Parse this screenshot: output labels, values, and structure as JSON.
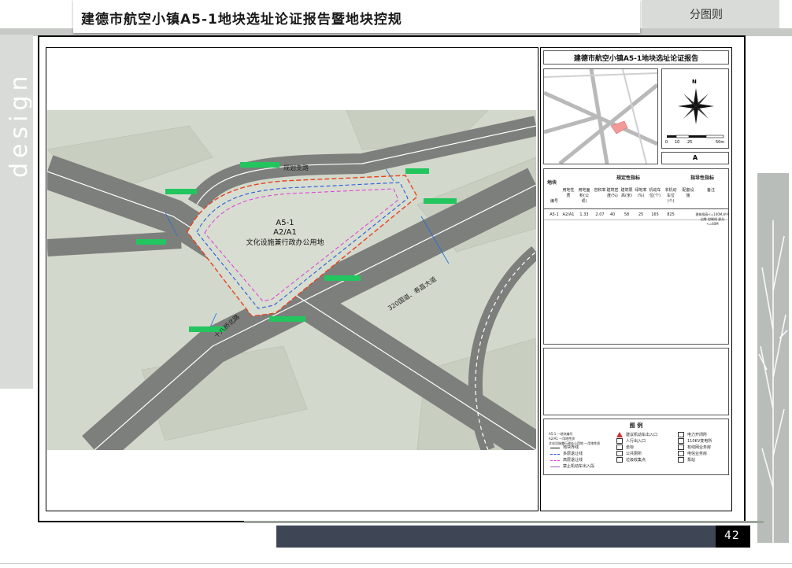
{
  "header": {
    "title": "建德市航空小镇A5-1地块选址论证报告暨地块控规",
    "section": "分图则"
  },
  "watermark": "design",
  "page_number": "42",
  "map": {
    "road_north": "规划支路",
    "road_east": "320国道、寿昌大道",
    "road_west": "十八桥北路",
    "parcel_code": "A5-1",
    "parcel_landuse": "A2/A1",
    "parcel_desc": "文化设施兼行政办公用地"
  },
  "panel": {
    "report_title": "建德市航空小镇A5-1地块选址论证报告",
    "locator_label": "A",
    "north_label": "N",
    "scale_labels": [
      "0",
      "10",
      "25",
      "50m"
    ],
    "table": {
      "group_left": "地块",
      "group_mid": "规定性指标",
      "group_right": "指导性指标",
      "headers": [
        "编号",
        "用地性质",
        "用地面积(公顷)",
        "容积率",
        "建筑密度(%)",
        "建筑限高(米)",
        "绿地率(%)",
        "机动车位(个)",
        "非机动车位(个)",
        "配套设施",
        "备注"
      ],
      "row": [
        "A5-1",
        "A2/A1",
        "1.33",
        "2.07",
        "40",
        "58",
        "25",
        "165",
        "825",
        "",
        "建筑限高<=100M,护坪边缘 控制线 部分<=60M"
      ]
    },
    "legend": {
      "title": "图 例",
      "sample_lines": [
        "A5-1 —地块编号",
        "A2/A1 —用地性质",
        "文化设施兼行政办公用地 —用地性质"
      ],
      "col1": [
        "地块界线",
        "多层退让线",
        "高层退让线",
        "禁止机动车出入段"
      ],
      "col2": [
        "建议机动车出入口",
        "人行出入口",
        "坐标",
        "公共厕所",
        "垃圾收集点"
      ],
      "col3": [
        "电力开闭所",
        "110KV变电所",
        "有线网业务房",
        "电信业务房",
        "泵站"
      ]
    }
  },
  "colors": {
    "map_bg": "#d2d8cb",
    "road": "#7d7f7d",
    "parcel_line": "#e8431e",
    "multi_setback": "#2a5bd7",
    "high_setback": "#e03ad6",
    "bottom_bar": "#3e4655"
  }
}
